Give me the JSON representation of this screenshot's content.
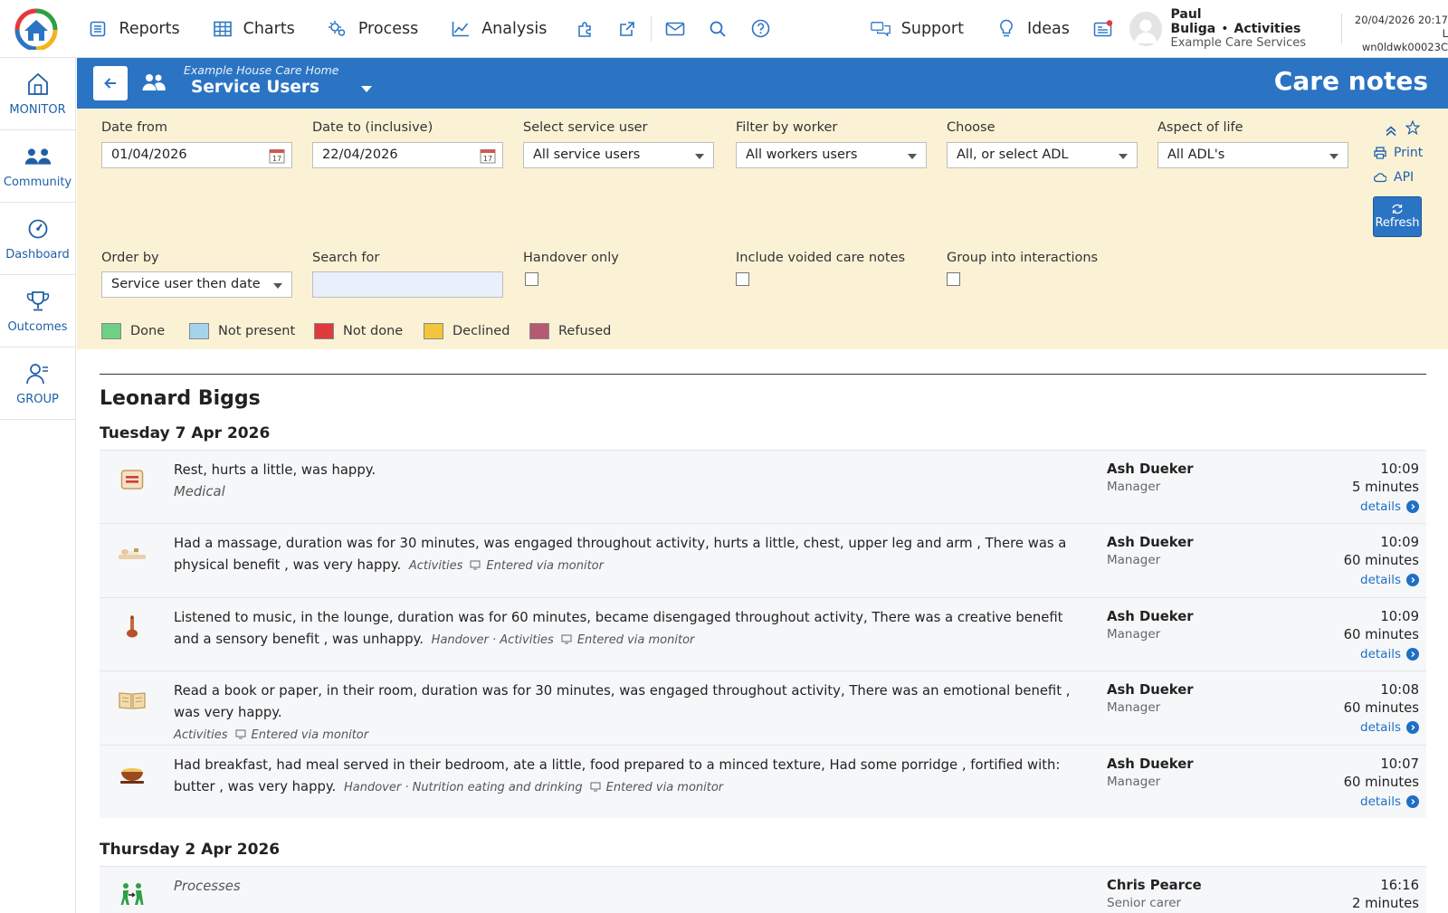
{
  "nav": {
    "items": [
      {
        "label": "Reports",
        "icon": "list-icon"
      },
      {
        "label": "Charts",
        "icon": "table-icon"
      },
      {
        "label": "Process",
        "icon": "process-icon"
      },
      {
        "label": "Analysis",
        "icon": "line-chart-icon"
      }
    ],
    "support_label": "Support",
    "ideas_label": "Ideas"
  },
  "user": {
    "name": "Paul Buliga",
    "separator": "•",
    "section": "Activities",
    "org": "Example Care Services"
  },
  "datetime": {
    "line1": "20/04/2026 20:17 L",
    "line2": "wn0ldwk00023C"
  },
  "sidebar": {
    "items": [
      {
        "label": "MONITOR",
        "icon": "home-icon"
      },
      {
        "label": "Community",
        "icon": "people-icon"
      },
      {
        "label": "Dashboard",
        "icon": "gauge-icon"
      },
      {
        "label": "Outcomes",
        "icon": "trophy-icon"
      },
      {
        "label": "GROUP",
        "icon": "group-icon"
      }
    ]
  },
  "header": {
    "home_name": "Example House Care Home",
    "subject": "Service Users",
    "page_title": "Care notes"
  },
  "filters": {
    "date_from_label": "Date from",
    "date_from_value": "01/04/2026",
    "date_to_label": "Date to (inclusive)",
    "date_to_value": "22/04/2026",
    "service_user_label": "Select service user",
    "service_user_value": "All service users",
    "worker_label": "Filter by worker",
    "worker_value": "All workers users",
    "choose_label": "Choose",
    "choose_value": "All, or select ADL",
    "aspect_label": "Aspect of life",
    "aspect_value": "All ADL's",
    "order_label": "Order by",
    "order_value": "Service user then date",
    "search_label": "Search for",
    "search_value": "",
    "handover_label": "Handover only",
    "voided_label": "Include voided care notes",
    "group_label": "Group into interactions",
    "print_label": "Print",
    "api_label": "API",
    "refresh_label": "Refresh",
    "cal_day": "17"
  },
  "legend": [
    {
      "label": "Done",
      "color": "#6fcf85"
    },
    {
      "label": "Not present",
      "color": "#a6d3ec"
    },
    {
      "label": "Not done",
      "color": "#e03a3a"
    },
    {
      "label": "Declined",
      "color": "#f2c53d"
    },
    {
      "label": "Refused",
      "color": "#b45a72"
    }
  ],
  "content": {
    "person": "Leonard Biggs",
    "days": [
      {
        "label": "Tuesday 7 Apr 2026",
        "notes": [
          {
            "icon": "medical-icon",
            "text": "Rest, hurts a little, was happy.",
            "category": "Medical",
            "meta": "",
            "monitor": "",
            "worker": "Ash Dueker",
            "role": "Manager",
            "time": "10:09",
            "duration": "5 minutes",
            "details": "details"
          },
          {
            "icon": "massage-icon",
            "text": "Had a massage, duration was for 30 minutes, was engaged throughout activity, hurts a little, chest, upper leg and arm , There was a physical benefit , was very happy.",
            "category": "",
            "meta": "Activities",
            "monitor": "Entered via monitor",
            "worker": "Ash Dueker",
            "role": "Manager",
            "time": "10:09",
            "duration": "60 minutes",
            "details": "details"
          },
          {
            "icon": "music-icon",
            "text": "Listened to music, in the lounge, duration was for 60 minutes, became disengaged throughout activity, There was a creative benefit and a sensory benefit , was unhappy.",
            "category": "",
            "meta": "Handover · Activities",
            "monitor": "Entered via monitor",
            "worker": "Ash Dueker",
            "role": "Manager",
            "time": "10:09",
            "duration": "60 minutes",
            "details": "details"
          },
          {
            "icon": "book-icon",
            "text": "Read a book or paper, in their room, duration was for 30 minutes, was engaged throughout activity, There was an emotional benefit , was very happy.",
            "category": "",
            "meta": "Activities",
            "monitor": "Entered via monitor",
            "worker": "Ash Dueker",
            "role": "Manager",
            "time": "10:08",
            "duration": "60 minutes",
            "details": "details"
          },
          {
            "icon": "bowl-icon",
            "text": "Had breakfast, had meal served in their bedroom, ate a little, food prepared to a minced texture, Had some porridge , fortified with: butter , was very happy.",
            "category": "",
            "meta": "Handover · Nutrition eating and drinking",
            "monitor": "Entered via monitor",
            "worker": "Ash Dueker",
            "role": "Manager",
            "time": "10:07",
            "duration": "60 minutes",
            "details": "details"
          }
        ]
      },
      {
        "label": "Thursday 2 Apr 2026",
        "notes": [
          {
            "icon": "process-people-icon",
            "text": "",
            "category": "Processes",
            "meta": "",
            "monitor": "",
            "worker": "Chris Pearce",
            "role": "Senior carer",
            "time": "16:16",
            "duration": "2 minutes",
            "details": ""
          }
        ]
      }
    ]
  }
}
